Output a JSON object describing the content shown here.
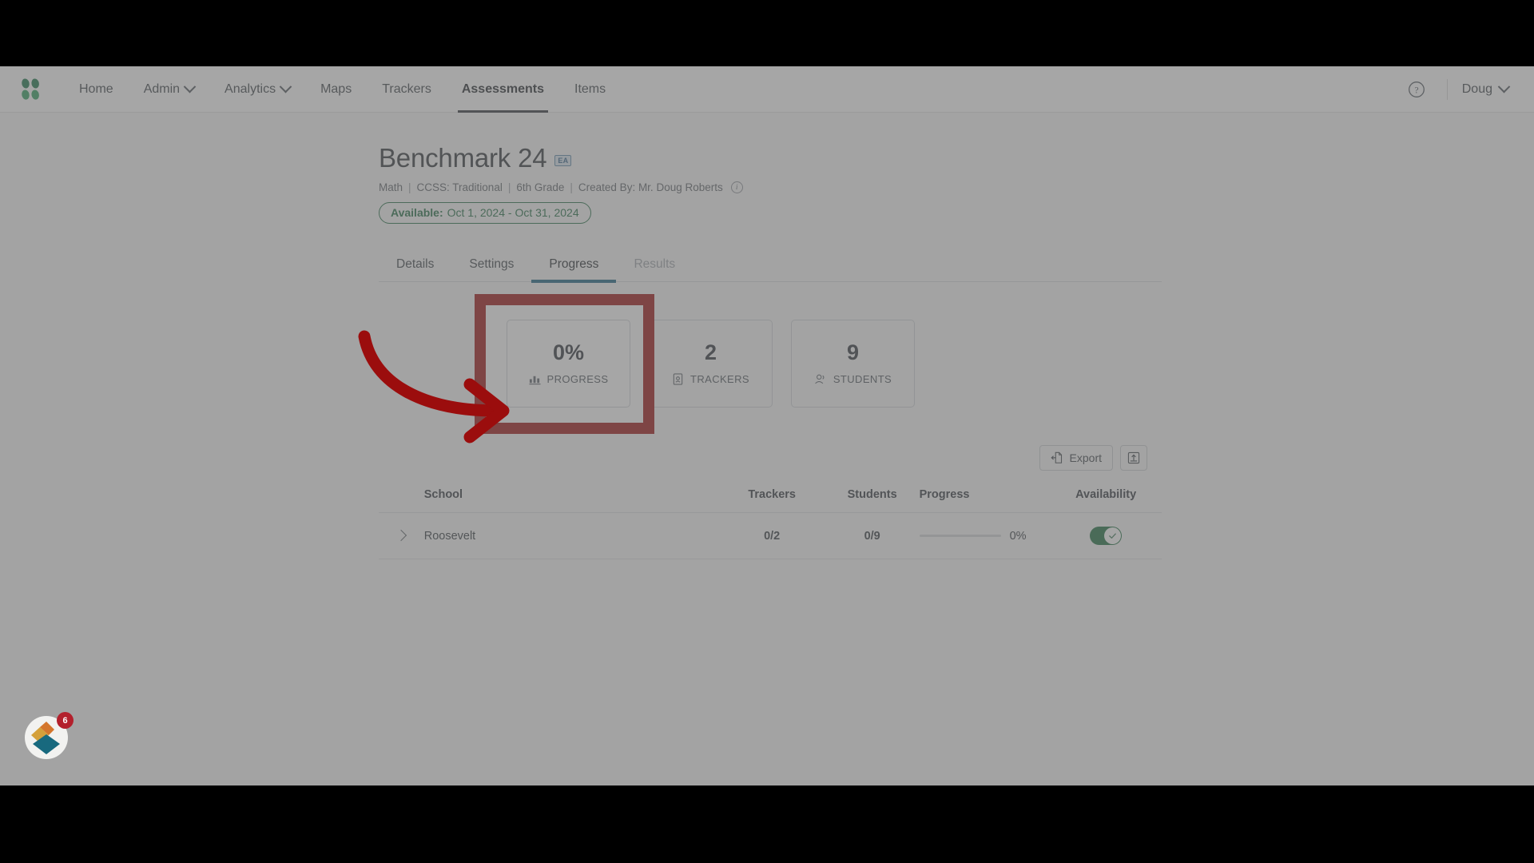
{
  "nav": {
    "logo_name": "brand-logo",
    "items": [
      {
        "label": "Home",
        "has_caret": false,
        "active": false
      },
      {
        "label": "Admin",
        "has_caret": true,
        "active": false
      },
      {
        "label": "Analytics",
        "has_caret": true,
        "active": false
      },
      {
        "label": "Maps",
        "has_caret": false,
        "active": false
      },
      {
        "label": "Trackers",
        "has_caret": false,
        "active": false
      },
      {
        "label": "Assessments",
        "has_caret": false,
        "active": true
      },
      {
        "label": "Items",
        "has_caret": false,
        "active": false
      }
    ],
    "help_icon": "question-circle-icon",
    "user_name": "Doug",
    "user_caret": "chevron-down-icon"
  },
  "page": {
    "title": "Benchmark 24",
    "badge": "EA",
    "meta": {
      "subject": "Math",
      "standard": "CCSS: Traditional",
      "grade": "6th Grade",
      "creator": "Created By: Mr. Doug Roberts",
      "separator": "|",
      "info_icon": "info-circle-icon",
      "info_glyph": "i"
    },
    "availability": {
      "label": "Available:",
      "range": "Oct 1, 2024 - Oct 31, 2024"
    }
  },
  "tabs": [
    {
      "label": "Details",
      "active": false,
      "disabled": false
    },
    {
      "label": "Settings",
      "active": false,
      "disabled": false
    },
    {
      "label": "Progress",
      "active": true,
      "disabled": false
    },
    {
      "label": "Results",
      "active": false,
      "disabled": true
    }
  ],
  "stats": [
    {
      "value": "0%",
      "label": "PROGRESS",
      "icon": "bar-chart-icon",
      "highlighted": true
    },
    {
      "value": "2",
      "label": "TRACKERS",
      "icon": "tracker-icon",
      "highlighted": false
    },
    {
      "value": "9",
      "label": "STUDENTS",
      "icon": "students-icon",
      "highlighted": false
    }
  ],
  "toolbar": {
    "export_label": "Export",
    "export_icon": "export-file-icon",
    "import_icon": "upload-icon"
  },
  "table": {
    "headers": {
      "school": "School",
      "trackers": "Trackers",
      "students": "Students",
      "progress": "Progress",
      "availability": "Availability"
    },
    "rows": [
      {
        "expand_icon": "chevron-right-icon",
        "school": "Roosevelt",
        "trackers": "0/2",
        "students": "0/9",
        "progress_pct_text": "0%",
        "progress_pct_value": 0,
        "availability_on": true,
        "availability_icon": "check-icon"
      }
    ]
  },
  "widget": {
    "name": "help-resource-widget",
    "badge_count": "6"
  },
  "annotation": {
    "arrow_name": "red-callout-arrow",
    "highlight_name": "red-highlight-box"
  },
  "colors": {
    "accent_blue": "#146080",
    "accent_green": "#1f6b42",
    "annotation_red": "#9b0d0d",
    "badge_red": "#b3202c",
    "toggle_green": "#1a6b3c",
    "brand_green": "#157347"
  }
}
